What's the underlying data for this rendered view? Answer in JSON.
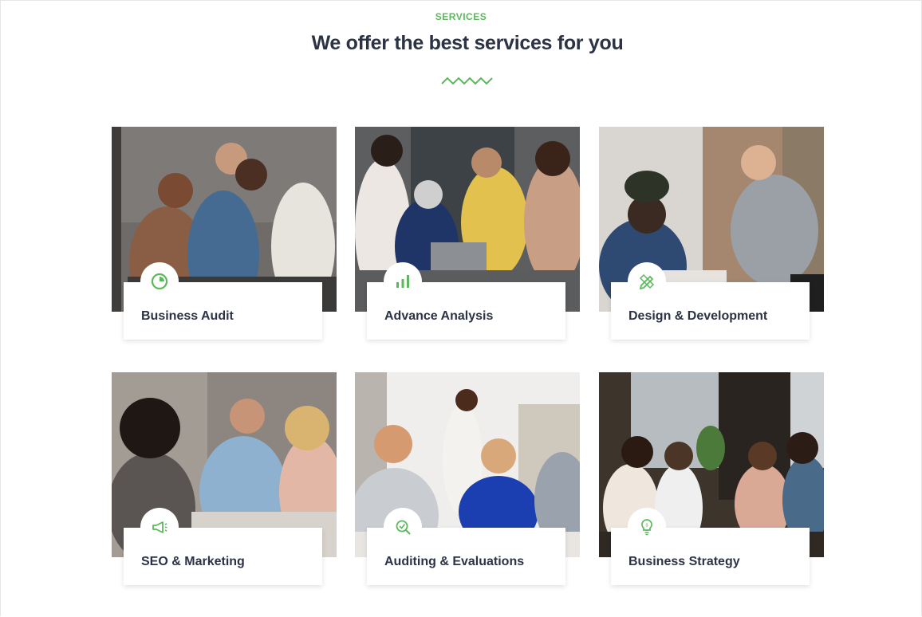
{
  "section": {
    "eyebrow": "SERVICES",
    "title": "We offer the best services for you"
  },
  "colors": {
    "accent": "#5cb85c",
    "heading": "#2b3344"
  },
  "services": [
    {
      "label": "Business Audit",
      "icon": "pie-chart-icon"
    },
    {
      "label": "Advance Analysis",
      "icon": "bar-chart-icon"
    },
    {
      "label": "Design & Development",
      "icon": "pencil-ruler-icon"
    },
    {
      "label": "SEO & Marketing",
      "icon": "megaphone-icon"
    },
    {
      "label": "Auditing & Evaluations",
      "icon": "magnifier-check-icon"
    },
    {
      "label": "Business Strategy",
      "icon": "lightbulb-icon"
    }
  ]
}
